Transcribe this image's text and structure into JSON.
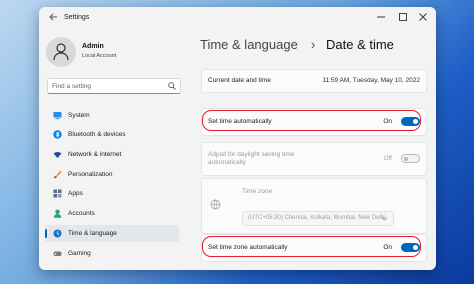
{
  "window": {
    "title": "Settings",
    "back_icon": "arrow-left-icon",
    "controls": [
      "minimize-icon",
      "maximize-icon",
      "close-icon"
    ]
  },
  "user": {
    "name": "Admin",
    "account": "Local Account"
  },
  "search": {
    "placeholder": "Find a setting",
    "icon": "search-icon"
  },
  "sidebar": {
    "items": [
      {
        "label": "System",
        "icon": "monitor-icon",
        "color": "#0f7fd8"
      },
      {
        "label": "Bluetooth & devices",
        "icon": "bluetooth-icon",
        "color": "#0f7fd8"
      },
      {
        "label": "Network & internet",
        "icon": "wifi-icon",
        "color": "#1a4f9c"
      },
      {
        "label": "Personalization",
        "icon": "brush-icon",
        "color": "#e07b22"
      },
      {
        "label": "Apps",
        "icon": "apps-icon",
        "color": "#5a6b85"
      },
      {
        "label": "Accounts",
        "icon": "person-icon",
        "color": "#2aa36b"
      },
      {
        "label": "Time & language",
        "icon": "globe-clock-icon",
        "color": "#1a74c9"
      },
      {
        "label": "Gaming",
        "icon": "gamepad-icon",
        "color": "#7a7a7a"
      }
    ],
    "active_index": 6
  },
  "breadcrumb": {
    "parent": "Time & language",
    "separator": "›",
    "current": "Date & time"
  },
  "settings": {
    "current_date": {
      "label": "Current date and time",
      "value": "11:59 AM, Tuesday, May 10, 2022"
    },
    "set_time_auto": {
      "label": "Set time automatically",
      "state": "On"
    },
    "daylight_saving": {
      "label_line1": "Adjust for daylight saving time",
      "label_line2": "automatically",
      "state": "Off"
    },
    "time_zone": {
      "label": "Time zone",
      "value": "(UTC+05:30) Chennai, Kolkata, Mumbai, New Delhi",
      "icon": "globe-icon"
    },
    "set_tz_auto": {
      "label": "Set time zone automatically",
      "state": "On"
    }
  },
  "colors": {
    "accent": "#0067c0",
    "highlight": "#e0202a"
  }
}
